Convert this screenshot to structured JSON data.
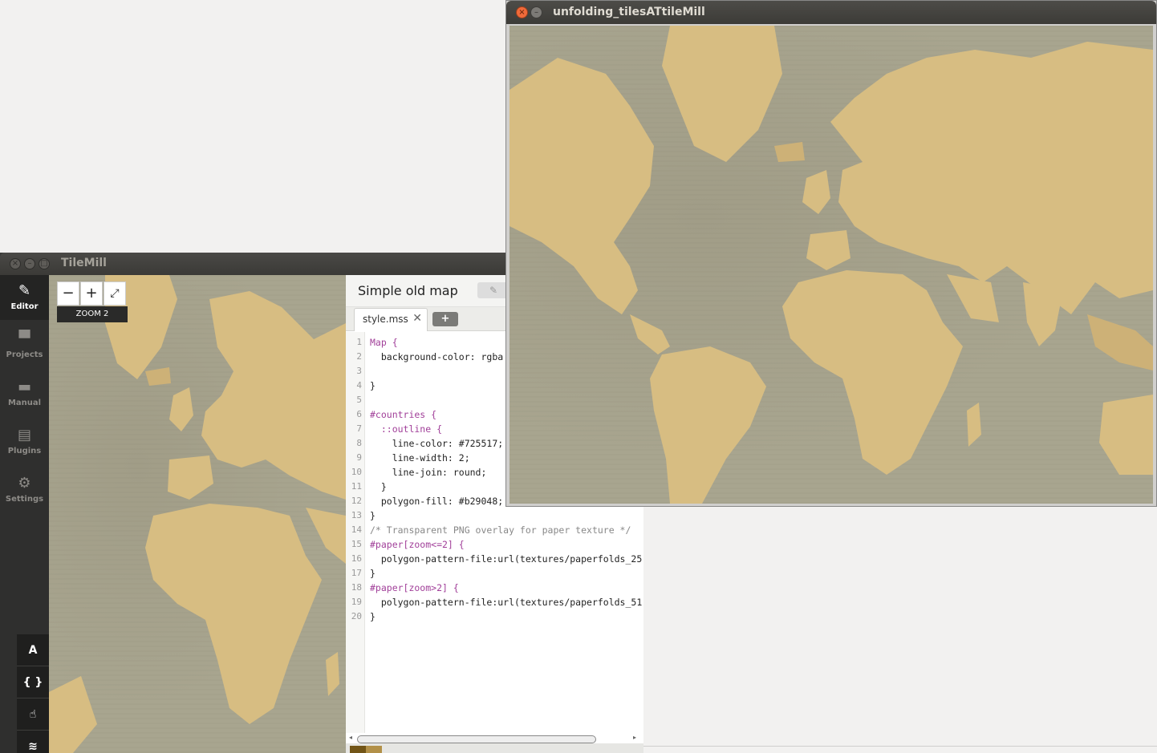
{
  "tilemill": {
    "window_title": "TileMill",
    "window_buttons": [
      "×",
      "–",
      "□"
    ],
    "sidebar": [
      {
        "label": "Editor",
        "icon": "pencil-icon",
        "glyph": "✎",
        "active": true
      },
      {
        "label": "Projects",
        "icon": "folder-icon",
        "glyph": "▀"
      },
      {
        "label": "Manual",
        "icon": "book-icon",
        "glyph": "▬"
      },
      {
        "label": "Plugins",
        "icon": "plug-icon",
        "glyph": "▤"
      },
      {
        "label": "Settings",
        "icon": "gear-icon",
        "glyph": "⚙"
      }
    ],
    "tools": [
      {
        "name": "font-tool",
        "glyph": "A"
      },
      {
        "name": "carto-tool",
        "glyph": "{ }"
      },
      {
        "name": "interaction-tool",
        "glyph": "☝"
      },
      {
        "name": "layers-tool",
        "glyph": "≋"
      }
    ],
    "map": {
      "zoom_out": "−",
      "zoom_in": "+",
      "fullscreen": "⤢",
      "zoom_label": "ZOOM 2"
    },
    "editor": {
      "project_title": "Simple old map",
      "edit_glyph": "✎",
      "tab_label": "style.mss",
      "tab_close": "✕",
      "add_tab": "+",
      "code_lines": [
        "Map {",
        "  background-color: rgba",
        "",
        "}",
        "",
        "#countries {",
        "  ::outline {",
        "    line-color: #725517;",
        "    line-width: 2;",
        "    line-join: round;",
        "  }",
        "  polygon-fill: #b29048;",
        "}",
        "/* Transparent PNG overlay for paper texture */",
        "#paper[zoom<=2] {",
        "  polygon-pattern-file:url(textures/paperfolds_25",
        "}",
        "#paper[zoom>2] {",
        "  polygon-pattern-file:url(textures/paperfolds_51",
        "}"
      ],
      "swatches": [
        "#725517",
        "#b29048"
      ]
    }
  },
  "unfolding": {
    "window_title": "unfolding_tilesATtileMill",
    "close_glyph": "×",
    "min_glyph": "–"
  },
  "colors": {
    "land": "#d7bd82",
    "water": "#a8a58f"
  }
}
